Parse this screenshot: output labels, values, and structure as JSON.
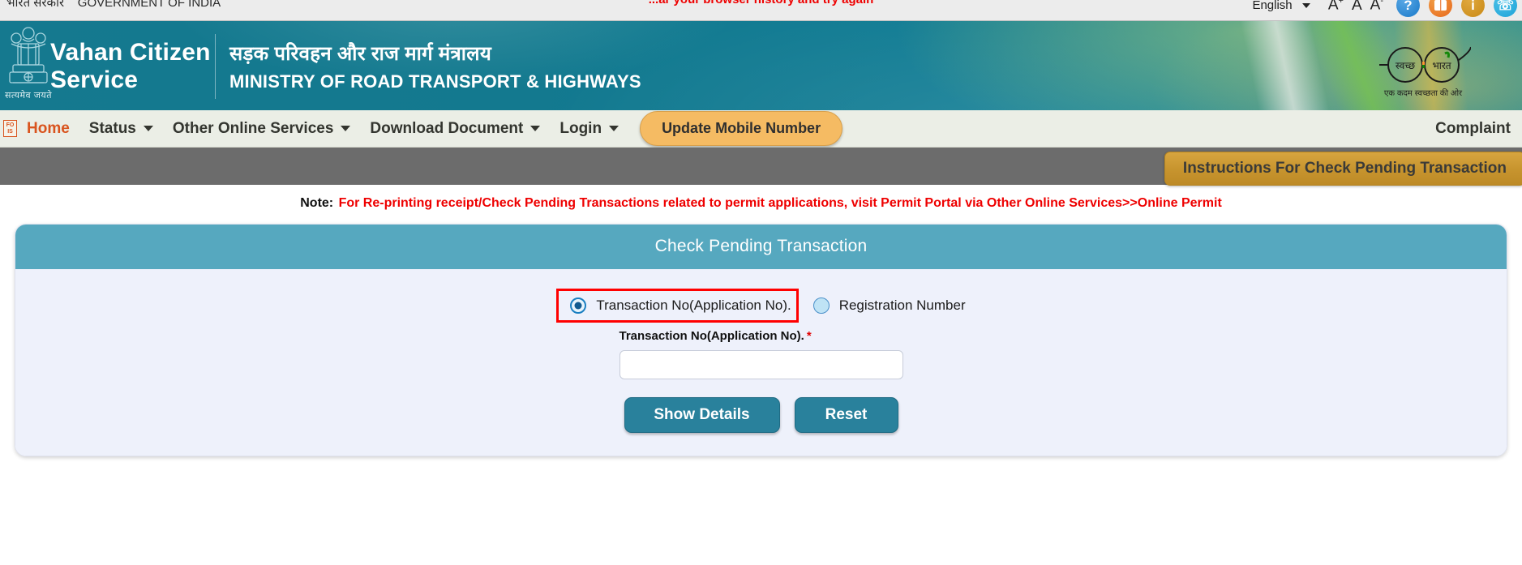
{
  "topbar": {
    "gov_hindi": "भारत सरकार",
    "gov_english": "GOVERNMENT OF INDIA",
    "browser_warning": "...ar your browser history and try again",
    "language": "English",
    "font_increase": "A",
    "font_normal": "A",
    "font_decrease": "A",
    "icons": {
      "help": "help-icon",
      "book": "book-icon",
      "info": "info-icon",
      "phone": "phone-icon"
    }
  },
  "banner": {
    "brand_line1": "Vahan Citizen",
    "brand_line2": "Service",
    "emblem_caption": "सत्यमेव जयते",
    "ministry_hindi": "सड़क परिवहन और राज मार्ग मंत्रालय",
    "ministry_english": "MINISTRY OF ROAD TRANSPORT & HIGHWAYS",
    "swachh_left": "स्वच्छ",
    "swachh_right": "भारत",
    "swachh_tagline": "एक कदम स्वच्छता की ओर"
  },
  "nav": {
    "fois_line1": "FO",
    "fois_line2": "IS",
    "items": [
      {
        "label": "Home",
        "has_caret": false
      },
      {
        "label": "Status",
        "has_caret": true
      },
      {
        "label": "Other Online Services",
        "has_caret": true
      },
      {
        "label": "Download Document",
        "has_caret": true
      },
      {
        "label": "Login",
        "has_caret": true
      }
    ],
    "update_mobile_label": "Update Mobile Number",
    "complaint_label": "Complaint"
  },
  "instructions": {
    "button_label": "Instructions For Check Pending Transaction"
  },
  "note": {
    "prefix": "Note:",
    "text": "For Re-printing receipt/Check Pending Transactions related to permit applications, visit Permit Portal via Other Online Services>>Online Permit"
  },
  "card": {
    "title": "Check Pending Transaction",
    "radio_options": [
      {
        "label": "Transaction No(Application No).",
        "selected": true,
        "highlighted": true
      },
      {
        "label": "Registration Number",
        "selected": false,
        "highlighted": false
      }
    ],
    "field_label": "Transaction No(Application No).",
    "field_required_mark": "*",
    "field_value": "",
    "field_placeholder": "",
    "show_button": "Show Details",
    "reset_button": "Reset"
  },
  "colors": {
    "banner_teal": "#13798f",
    "card_header": "#56a8bf",
    "card_body": "#eef1fb",
    "button_teal": "#29819c",
    "accent_orange": "#d9541e",
    "pill_orange": "#f5bb63",
    "instructions_gold": "#c8952f",
    "alert_red": "#ee0000",
    "highlight_red": "#ff0000",
    "grey_band": "#6c6c6c"
  }
}
